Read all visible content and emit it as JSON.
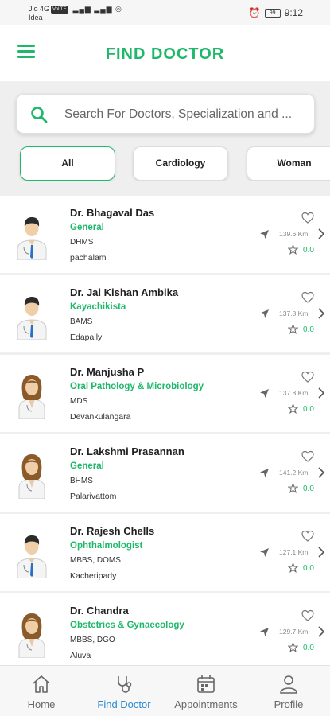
{
  "status_bar": {
    "carrier_line1": "Jio 4G",
    "carrier_badge": "VoLTE",
    "carrier_line2": "Idea",
    "battery": "99",
    "time": "9:12"
  },
  "header": {
    "title": "FIND DOCTOR",
    "menu_icon": "hamburger-menu-icon"
  },
  "search": {
    "placeholder": "Search For Doctors, Specialization and ..."
  },
  "filters": [
    {
      "label": "All",
      "active": true
    },
    {
      "label": "Cardiology",
      "active": false
    },
    {
      "label": "Woman",
      "active": false
    }
  ],
  "doctors": [
    {
      "name": "Dr. Bhagaval Das",
      "specialization": "General",
      "qualification": "DHMS",
      "location": "pachalam",
      "distance": "139.6 Km",
      "rating": "0.0",
      "gender": "male"
    },
    {
      "name": "Dr. Jai Kishan Ambika",
      "specialization": "Kayachikista",
      "qualification": "BAMS",
      "location": "Edapally",
      "distance": "137.8 Km",
      "rating": "0.0",
      "gender": "male"
    },
    {
      "name": "Dr. Manjusha  P",
      "specialization": "Oral Pathology & Microbiology",
      "qualification": "MDS",
      "location": "Devankulangara",
      "distance": "137.8 Km",
      "rating": "0.0",
      "gender": "female"
    },
    {
      "name": "Dr. Lakshmi Prasannan",
      "specialization": "General",
      "qualification": "BHMS",
      "location": "Palarivattom",
      "distance": "141.2 Km",
      "rating": "0.0",
      "gender": "female"
    },
    {
      "name": "Dr. Rajesh  Chells",
      "specialization": "Ophthalmologist",
      "qualification": "MBBS, DOMS",
      "location": "Kacheripady",
      "distance": "127.1 Km",
      "rating": "0.0",
      "gender": "male"
    },
    {
      "name": "Dr. Chandra",
      "specialization": "Obstetrics & Gynaecology",
      "qualification": "MBBS, DGO",
      "location": "Aluva",
      "distance": "129.7 Km",
      "rating": "0.0",
      "gender": "female"
    }
  ],
  "bottom_nav": [
    {
      "label": "Home",
      "icon": "home-icon",
      "active": false
    },
    {
      "label": "Find Doctor",
      "icon": "stethoscope-icon",
      "active": true
    },
    {
      "label": "Appointments",
      "icon": "calendar-icon",
      "active": false
    },
    {
      "label": "Profile",
      "icon": "user-icon",
      "active": false
    }
  ],
  "colors": {
    "accent": "#1fb86a",
    "active_nav": "#2a8ccf"
  }
}
